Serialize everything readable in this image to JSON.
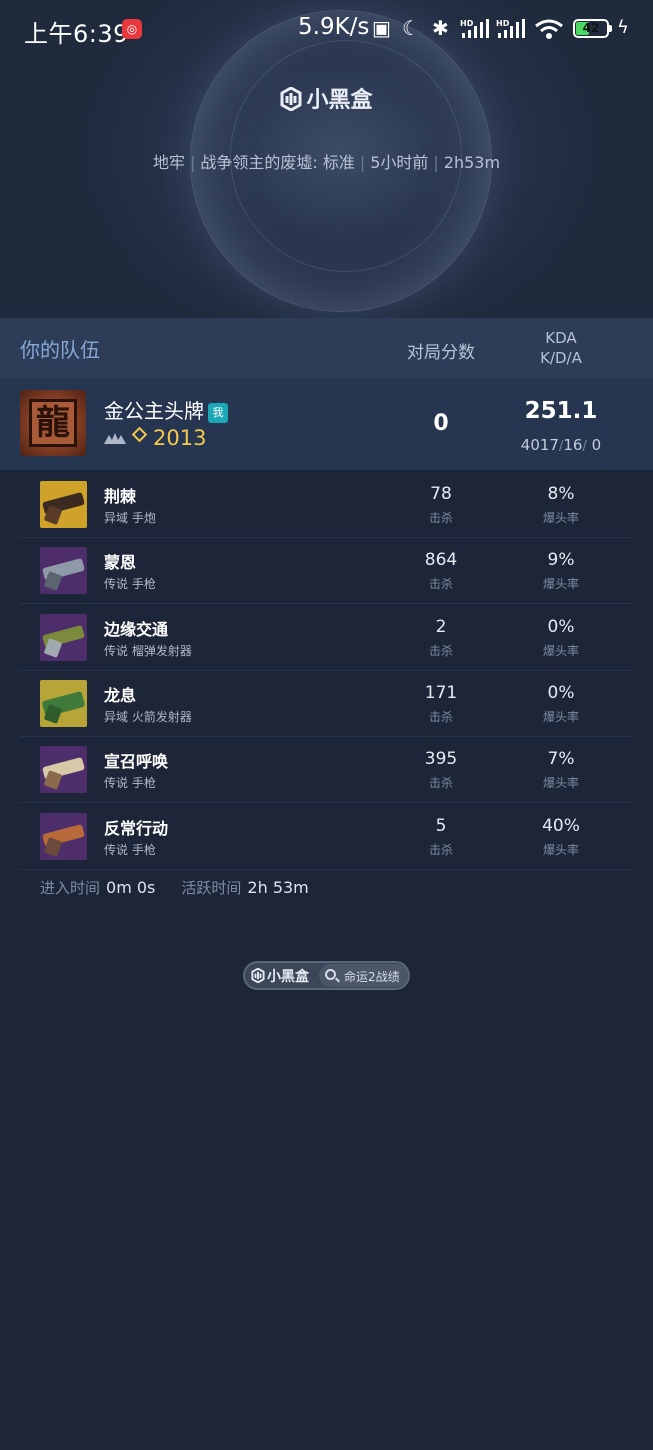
{
  "status_bar": {
    "time": "上午6:39",
    "app_notification": "◎",
    "net_speed": "5.9K/s",
    "battery_level": "42"
  },
  "header": {
    "brand": "小黑盒",
    "activity_type": "地牢",
    "activity_name": "战争领主的废墟: 标准",
    "time_ago": "5小时前",
    "duration": "2h53m"
  },
  "team": {
    "title": "你的队伍",
    "col_score": "对局分数",
    "col_kda_top": "KDA",
    "col_kda_bottom": "K/D/A"
  },
  "player": {
    "avatar_glyph": "龍",
    "name": "金公主头牌",
    "me_badge": "我",
    "power": "2013",
    "score": "0",
    "kda": "251.1",
    "kills": "4017",
    "deaths": "16",
    "assists": "0"
  },
  "weapons": [
    {
      "name": "荆棘",
      "type": "异域 手炮",
      "kills": "78",
      "kills_label": "击杀",
      "headshot": "8%",
      "headshot_label": "爆头率",
      "rarity": "exotic"
    },
    {
      "name": "蒙恩",
      "type": "传说 手枪",
      "kills": "864",
      "kills_label": "击杀",
      "headshot": "9%",
      "headshot_label": "爆头率",
      "rarity": "legendary"
    },
    {
      "name": "边缘交通",
      "type": "传说 榴弹发射器",
      "kills": "2",
      "kills_label": "击杀",
      "headshot": "0%",
      "headshot_label": "爆头率",
      "rarity": "legendary"
    },
    {
      "name": "龙息",
      "type": "异域 火箭发射器",
      "kills": "171",
      "kills_label": "击杀",
      "headshot": "0%",
      "headshot_label": "爆头率",
      "rarity": "exotic"
    },
    {
      "name": "宣召呼唤",
      "type": "传说 手枪",
      "kills": "395",
      "kills_label": "击杀",
      "headshot": "7%",
      "headshot_label": "爆头率",
      "rarity": "legendary"
    },
    {
      "name": "反常行动",
      "type": "传说 手枪",
      "kills": "5",
      "kills_label": "击杀",
      "headshot": "40%",
      "headshot_label": "爆头率",
      "rarity": "legendary"
    }
  ],
  "times": {
    "enter_label": "进入时间",
    "enter_value": "0m 0s",
    "active_label": "活跃时间",
    "active_value": "2h 53m"
  },
  "footer": {
    "brand": "小黑盒",
    "search_text": "命运2战绩"
  },
  "colors": {
    "background": "#1c2638",
    "team_header": "#2d3d57",
    "player_row": "#263550",
    "accent_blue": "#86a7d6",
    "power_gold": "#f2c94c",
    "exotic": "#cfa22a",
    "legendary": "#4e2d6b"
  }
}
